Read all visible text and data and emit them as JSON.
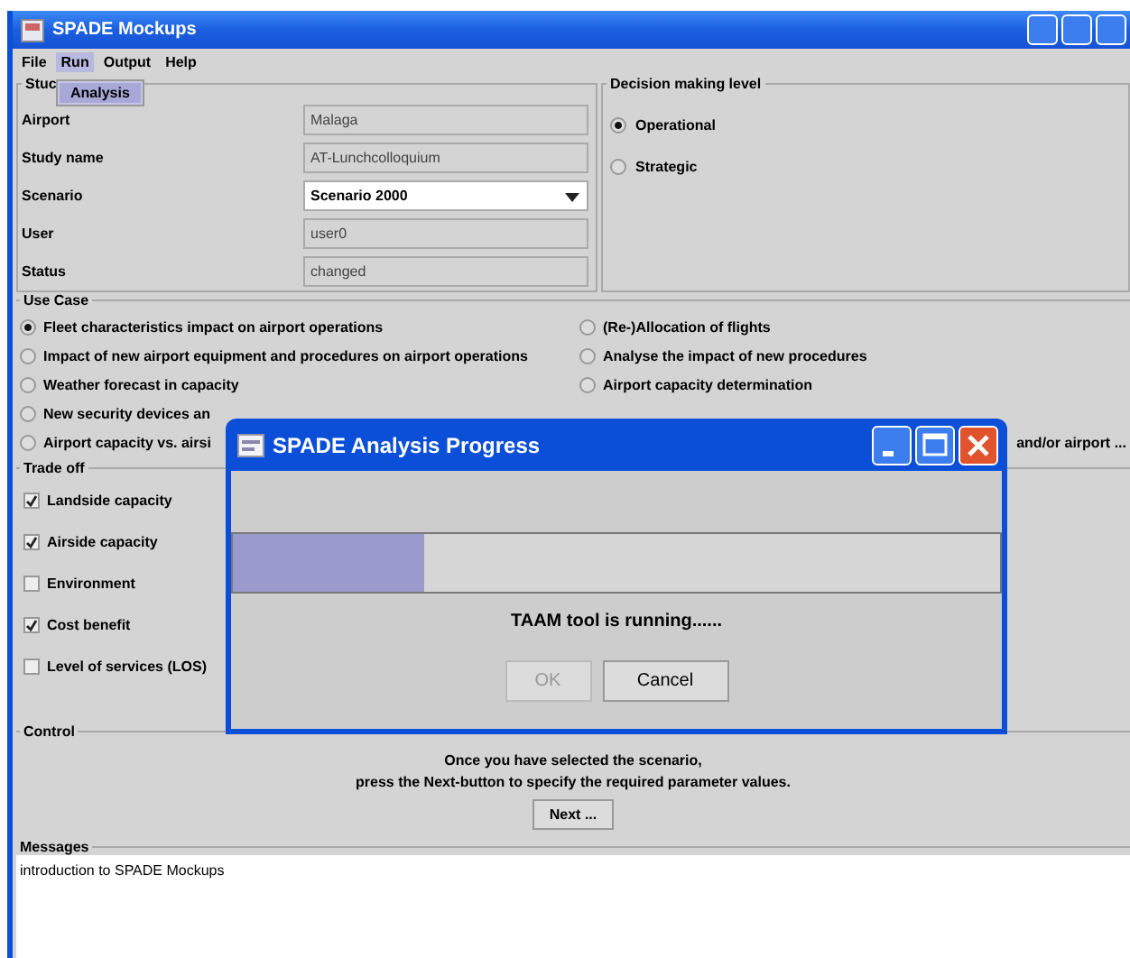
{
  "window": {
    "title": "SPADE Mockups"
  },
  "menu": [
    {
      "label": "File",
      "selected": false
    },
    {
      "label": "Run",
      "selected": true
    },
    {
      "label": "Output",
      "selected": false
    },
    {
      "label": "Help",
      "selected": false
    }
  ],
  "run_menu": [
    {
      "label": "Analysis",
      "selected": true
    }
  ],
  "study": {
    "title": "Stuc",
    "fields": [
      {
        "label": "Airport",
        "value": "Malaga",
        "kind": "text"
      },
      {
        "label": "Study name",
        "value": "AT-Lunchcolloquium",
        "kind": "text"
      },
      {
        "label": "Scenario",
        "value": "Scenario 2000",
        "kind": "combo"
      },
      {
        "label": "User",
        "value": "user0",
        "kind": "text"
      },
      {
        "label": "Status",
        "value": "changed",
        "kind": "text"
      }
    ]
  },
  "decision": {
    "title": "Decision making level",
    "options": [
      {
        "label": "Operational",
        "selected": true
      },
      {
        "label": "Strategic",
        "selected": false
      }
    ]
  },
  "use_case": {
    "title": "Use Case",
    "left_options": [
      {
        "label": "Fleet characteristics impact on airport operations",
        "selected": true
      },
      {
        "label": "Impact of new airport equipment and procedures on airport operations",
        "selected": false
      },
      {
        "label": "Weather forecast in capacity",
        "selected": false
      },
      {
        "label": "New security devices an",
        "selected": false
      },
      {
        "label": "Airport capacity vs. airsi",
        "selected": false
      }
    ],
    "right_options": [
      {
        "label": "(Re-)Allocation of flights",
        "selected": false
      },
      {
        "label": "Analyse the impact of new procedures",
        "selected": false
      },
      {
        "label": "Airport capacity determination",
        "selected": false
      }
    ],
    "right_overflow_text": "and/or airport ..."
  },
  "trade_off": {
    "title": "Trade off",
    "options": [
      {
        "label": "Landside capacity",
        "checked": true
      },
      {
        "label": "Airside capacity",
        "checked": true
      },
      {
        "label": "Environment",
        "checked": false
      },
      {
        "label": "Cost benefit",
        "checked": true
      },
      {
        "label": "Level of services (LOS)",
        "checked": false
      }
    ]
  },
  "control": {
    "title": "Control",
    "lines": [
      "Once you have selected the scenario,",
      "press the Next-button to specify the required parameter values."
    ],
    "button": "Next ..."
  },
  "messages": {
    "title": "Messages",
    "text": "introduction to SPADE Mockups"
  },
  "dialog": {
    "title": "SPADE Analysis Progress",
    "level": 0.25,
    "status": "TAAM tool is running......",
    "buttons": [
      {
        "label": "OK",
        "disabled": true
      },
      {
        "label": "Cancel",
        "disabled": false
      }
    ]
  }
}
